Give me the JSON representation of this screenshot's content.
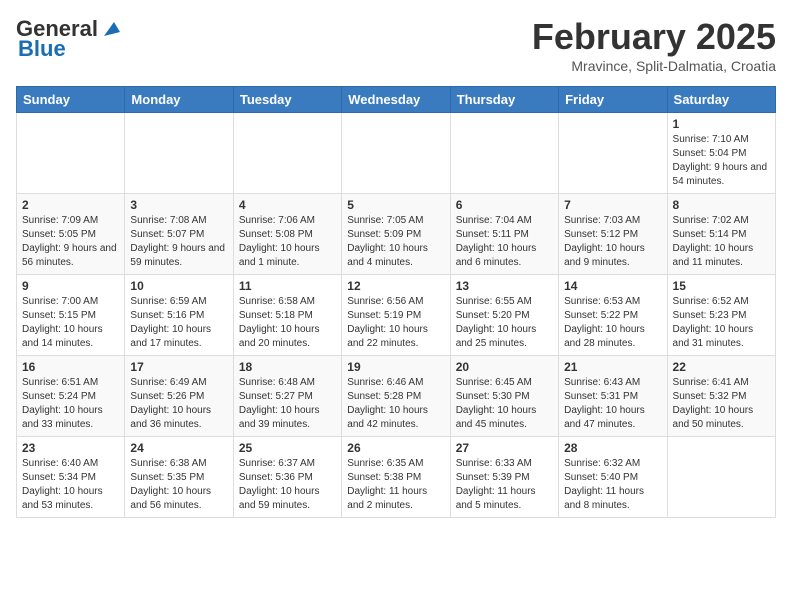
{
  "header": {
    "logo_general": "General",
    "logo_blue": "Blue",
    "month_year": "February 2025",
    "location": "Mravince, Split-Dalmatia, Croatia"
  },
  "weekdays": [
    "Sunday",
    "Monday",
    "Tuesday",
    "Wednesday",
    "Thursday",
    "Friday",
    "Saturday"
  ],
  "weeks": [
    [
      {
        "day": "",
        "info": ""
      },
      {
        "day": "",
        "info": ""
      },
      {
        "day": "",
        "info": ""
      },
      {
        "day": "",
        "info": ""
      },
      {
        "day": "",
        "info": ""
      },
      {
        "day": "",
        "info": ""
      },
      {
        "day": "1",
        "info": "Sunrise: 7:10 AM\nSunset: 5:04 PM\nDaylight: 9 hours and 54 minutes."
      }
    ],
    [
      {
        "day": "2",
        "info": "Sunrise: 7:09 AM\nSunset: 5:05 PM\nDaylight: 9 hours and 56 minutes."
      },
      {
        "day": "3",
        "info": "Sunrise: 7:08 AM\nSunset: 5:07 PM\nDaylight: 9 hours and 59 minutes."
      },
      {
        "day": "4",
        "info": "Sunrise: 7:06 AM\nSunset: 5:08 PM\nDaylight: 10 hours and 1 minute."
      },
      {
        "day": "5",
        "info": "Sunrise: 7:05 AM\nSunset: 5:09 PM\nDaylight: 10 hours and 4 minutes."
      },
      {
        "day": "6",
        "info": "Sunrise: 7:04 AM\nSunset: 5:11 PM\nDaylight: 10 hours and 6 minutes."
      },
      {
        "day": "7",
        "info": "Sunrise: 7:03 AM\nSunset: 5:12 PM\nDaylight: 10 hours and 9 minutes."
      },
      {
        "day": "8",
        "info": "Sunrise: 7:02 AM\nSunset: 5:14 PM\nDaylight: 10 hours and 11 minutes."
      }
    ],
    [
      {
        "day": "9",
        "info": "Sunrise: 7:00 AM\nSunset: 5:15 PM\nDaylight: 10 hours and 14 minutes."
      },
      {
        "day": "10",
        "info": "Sunrise: 6:59 AM\nSunset: 5:16 PM\nDaylight: 10 hours and 17 minutes."
      },
      {
        "day": "11",
        "info": "Sunrise: 6:58 AM\nSunset: 5:18 PM\nDaylight: 10 hours and 20 minutes."
      },
      {
        "day": "12",
        "info": "Sunrise: 6:56 AM\nSunset: 5:19 PM\nDaylight: 10 hours and 22 minutes."
      },
      {
        "day": "13",
        "info": "Sunrise: 6:55 AM\nSunset: 5:20 PM\nDaylight: 10 hours and 25 minutes."
      },
      {
        "day": "14",
        "info": "Sunrise: 6:53 AM\nSunset: 5:22 PM\nDaylight: 10 hours and 28 minutes."
      },
      {
        "day": "15",
        "info": "Sunrise: 6:52 AM\nSunset: 5:23 PM\nDaylight: 10 hours and 31 minutes."
      }
    ],
    [
      {
        "day": "16",
        "info": "Sunrise: 6:51 AM\nSunset: 5:24 PM\nDaylight: 10 hours and 33 minutes."
      },
      {
        "day": "17",
        "info": "Sunrise: 6:49 AM\nSunset: 5:26 PM\nDaylight: 10 hours and 36 minutes."
      },
      {
        "day": "18",
        "info": "Sunrise: 6:48 AM\nSunset: 5:27 PM\nDaylight: 10 hours and 39 minutes."
      },
      {
        "day": "19",
        "info": "Sunrise: 6:46 AM\nSunset: 5:28 PM\nDaylight: 10 hours and 42 minutes."
      },
      {
        "day": "20",
        "info": "Sunrise: 6:45 AM\nSunset: 5:30 PM\nDaylight: 10 hours and 45 minutes."
      },
      {
        "day": "21",
        "info": "Sunrise: 6:43 AM\nSunset: 5:31 PM\nDaylight: 10 hours and 47 minutes."
      },
      {
        "day": "22",
        "info": "Sunrise: 6:41 AM\nSunset: 5:32 PM\nDaylight: 10 hours and 50 minutes."
      }
    ],
    [
      {
        "day": "23",
        "info": "Sunrise: 6:40 AM\nSunset: 5:34 PM\nDaylight: 10 hours and 53 minutes."
      },
      {
        "day": "24",
        "info": "Sunrise: 6:38 AM\nSunset: 5:35 PM\nDaylight: 10 hours and 56 minutes."
      },
      {
        "day": "25",
        "info": "Sunrise: 6:37 AM\nSunset: 5:36 PM\nDaylight: 10 hours and 59 minutes."
      },
      {
        "day": "26",
        "info": "Sunrise: 6:35 AM\nSunset: 5:38 PM\nDaylight: 11 hours and 2 minutes."
      },
      {
        "day": "27",
        "info": "Sunrise: 6:33 AM\nSunset: 5:39 PM\nDaylight: 11 hours and 5 minutes."
      },
      {
        "day": "28",
        "info": "Sunrise: 6:32 AM\nSunset: 5:40 PM\nDaylight: 11 hours and 8 minutes."
      },
      {
        "day": "",
        "info": ""
      }
    ]
  ]
}
